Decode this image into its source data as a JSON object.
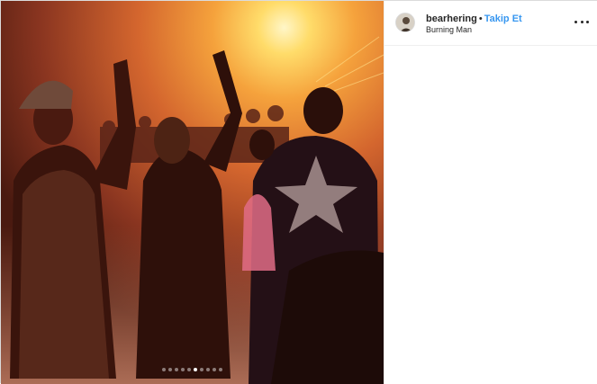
{
  "post": {
    "username": "bearhering",
    "separator": "•",
    "follow_label": "Takip Et",
    "location": "Burning Man",
    "more_icon": "more-options-icon",
    "avatar_icon": "avatar"
  },
  "carousel": {
    "total_slides": 10,
    "active_index": 5
  },
  "colors": {
    "follow": "#3897f0",
    "text": "#262626",
    "border": "#dbdbdb"
  }
}
